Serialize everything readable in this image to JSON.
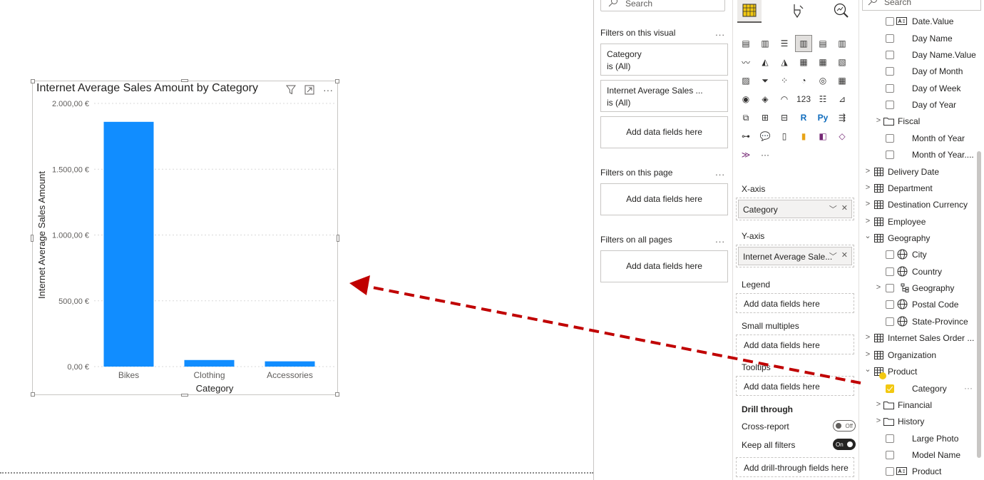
{
  "visual": {
    "title": "Internet Average Sales Amount by Category",
    "header_icons": [
      "filter-icon",
      "focus-mode-icon",
      "more-options-icon"
    ]
  },
  "chart_data": {
    "type": "bar",
    "title": "Internet Average Sales Amount by Category",
    "categories": [
      "Bikes",
      "Clothing",
      "Accessories"
    ],
    "values": [
      1860,
      50,
      40
    ],
    "xlabel": "Category",
    "ylabel": "Internet Average Sales Amount",
    "ylim": [
      0,
      2000
    ],
    "yticks": [
      0,
      500,
      1000,
      1500,
      2000
    ],
    "ytick_labels": [
      "0,00 €",
      "500,00 €",
      "1.000,00 €",
      "1.500,00 €",
      "2.000,00 €"
    ],
    "grid": true,
    "bar_color": "#118DFF"
  },
  "filters": {
    "search_placeholder": "Search",
    "on_visual_heading": "Filters on this visual",
    "more": "...",
    "visual_cards": [
      {
        "name": "Category",
        "state": "is (All)"
      },
      {
        "name": "Internet Average Sales ...",
        "state": "is (All)"
      }
    ],
    "add_data_fields": "Add data fields here",
    "on_page_heading": "Filters on this page",
    "on_all_pages_heading": "Filters on all pages"
  },
  "visualizations": {
    "xaxis_label": "X-axis",
    "xaxis_field": "Category",
    "yaxis_label": "Y-axis",
    "yaxis_field": "Internet Average Sale...",
    "legend_label": "Legend",
    "legend_placeholder": "Add data fields here",
    "small_multiples_label": "Small multiples",
    "small_multiples_placeholder": "Add data fields here",
    "tooltips_label": "Tooltips",
    "tooltips_placeholder": "Add data fields here",
    "drill_through_label": "Drill through",
    "cross_report_label": "Cross-report",
    "cross_report_state": "Off",
    "keep_filters_label": "Keep all filters",
    "keep_filters_state": "On",
    "drill_placeholder": "Add drill-through fields here",
    "more_visuals": "···"
  },
  "fields": {
    "search_placeholder": "Search",
    "items": [
      {
        "label": "Date.Value",
        "icon": "text-field-icon"
      },
      {
        "label": "Day Name"
      },
      {
        "label": "Day Name.Value"
      },
      {
        "label": "Day of Month"
      },
      {
        "label": "Day of Week"
      },
      {
        "label": "Day of Year"
      },
      {
        "label": "Fiscal",
        "icon": "folder-icon"
      },
      {
        "label": "Month of Year"
      },
      {
        "label": "Month of Year...."
      },
      {
        "label": "Delivery Date",
        "icon": "table-icon"
      },
      {
        "label": "Department",
        "icon": "table-icon"
      },
      {
        "label": "Destination Currency",
        "icon": "table-icon"
      },
      {
        "label": "Employee",
        "icon": "table-icon"
      },
      {
        "label": "Geography",
        "icon": "table-icon"
      },
      {
        "label": "City",
        "icon": "globe-icon"
      },
      {
        "label": "Country",
        "icon": "globe-icon"
      },
      {
        "label": "Geography",
        "icon": "hierarchy-icon"
      },
      {
        "label": "Postal Code",
        "icon": "globe-icon"
      },
      {
        "label": "State-Province",
        "icon": "globe-icon"
      },
      {
        "label": "Internet Sales Order ...",
        "icon": "table-icon"
      },
      {
        "label": "Organization",
        "icon": "table-icon"
      },
      {
        "label": "Product",
        "icon": "table-icon"
      },
      {
        "label": "Category"
      },
      {
        "label": "Financial",
        "icon": "folder-icon"
      },
      {
        "label": "History",
        "icon": "folder-icon"
      },
      {
        "label": "Large Photo"
      },
      {
        "label": "Model Name"
      },
      {
        "label": "Product",
        "icon": "text-field-icon"
      }
    ],
    "category_more": "···"
  },
  "annotation": {
    "arrow_color": "#C00000"
  }
}
